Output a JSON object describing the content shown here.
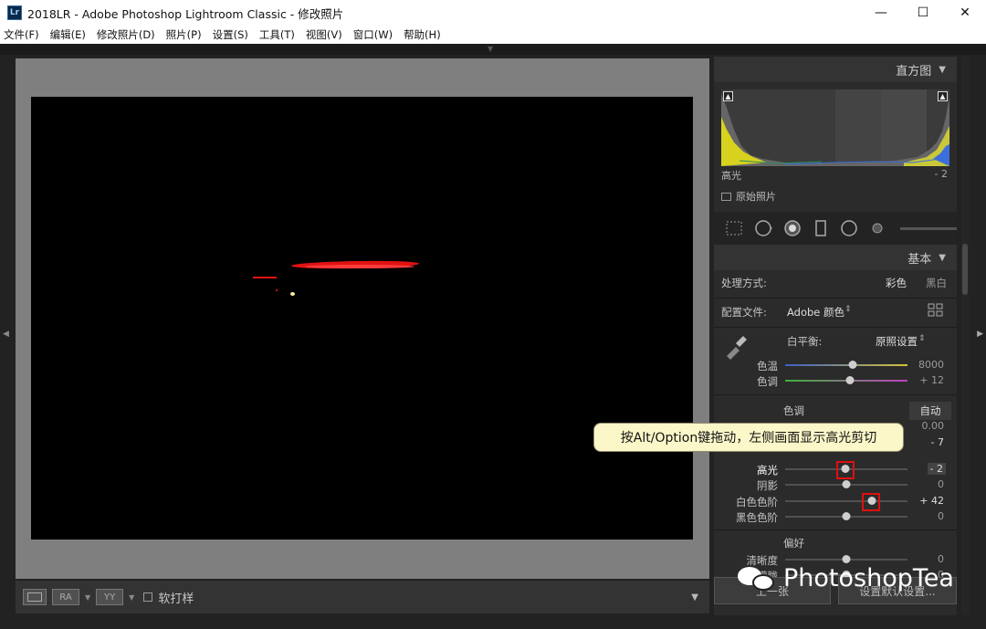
{
  "titlebar": {
    "app_icon": "Lr",
    "title": "2018LR - Adobe Photoshop Lightroom Classic - 修改照片",
    "minimize": "—",
    "maximize": "☐",
    "close": "✕"
  },
  "menu": [
    "文件(F)",
    "编辑(E)",
    "修改照片(D)",
    "照片(P)",
    "设置(S)",
    "工具(T)",
    "视图(V)",
    "窗口(W)",
    "帮助(H)"
  ],
  "toolbar": {
    "view_btn": "",
    "ra_btn": "RA",
    "yy_btn": "YY",
    "soft_proof": "软打样"
  },
  "panel": {
    "histogram": {
      "title": "直方图",
      "label": "高光",
      "value": "- 2",
      "original_photo": "原始照片"
    },
    "basic": {
      "title": "基本",
      "treatment_label": "处理方式:",
      "treatment_color": "彩色",
      "treatment_bw": "黑白",
      "profile_label": "配置文件:",
      "profile_value": "Adobe 颜色",
      "wb_label": "白平衡:",
      "wb_value": "原照设置",
      "temp_label": "色温",
      "temp_value": "8000",
      "tint_label": "色调",
      "tint_value": "+ 12",
      "tone_label": "色调",
      "auto_label": "自动",
      "exposure_value": "0.00",
      "contrast_value": "- 7",
      "highlights_label": "高光",
      "highlights_value": "- 2",
      "shadows_label": "阴影",
      "shadows_value": "0",
      "whites_label": "白色色阶",
      "whites_value": "+ 42",
      "blacks_label": "黑色色阶",
      "blacks_value": "0",
      "presence_label": "偏好",
      "clarity_label": "清晰度",
      "clarity_value": "0",
      "dehaze_label": "去朦胧",
      "dehaze_value": "0"
    },
    "sliders": {
      "temp": 0.55,
      "tint": 0.53,
      "highlights": 0.49,
      "shadows": 0.5,
      "whites": 0.71,
      "blacks": 0.5,
      "clarity": 0.5,
      "dehaze": 0.5
    },
    "bottom": {
      "prev_btn": "上一张",
      "reset_btn": "设置默认设置..."
    }
  },
  "callout": "按Alt/Option键拖动，左侧画面显示高光剪切",
  "watermark": "PhotoshopTea"
}
